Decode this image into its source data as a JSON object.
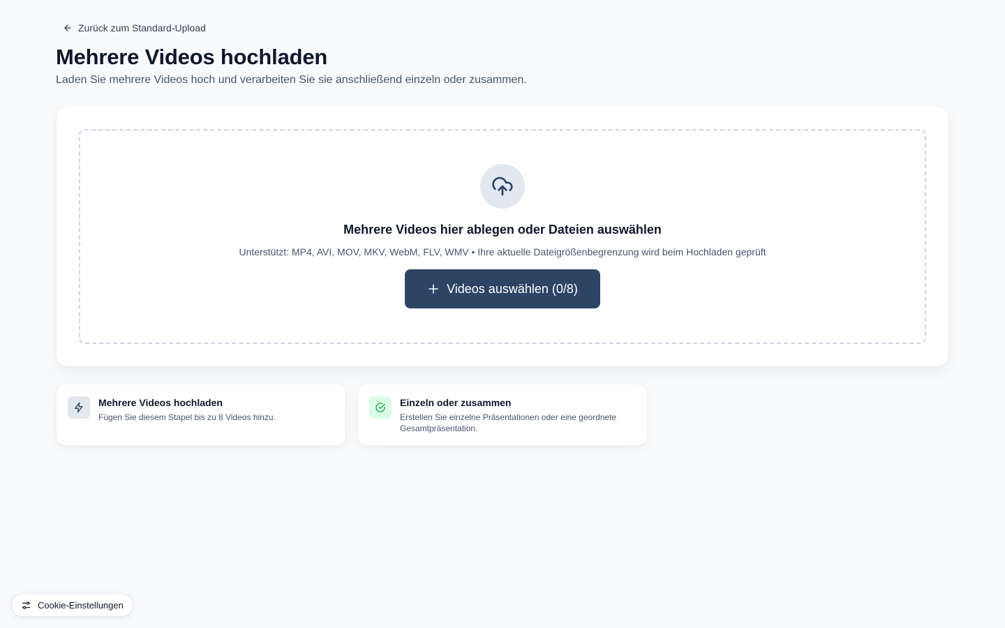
{
  "nav": {
    "back_label": "Zurück zum Standard-Upload"
  },
  "header": {
    "title": "Mehrere Videos hochladen",
    "subtitle": "Laden Sie mehrere Videos hoch und verarbeiten Sie sie anschließend einzeln oder zusammen."
  },
  "dropzone": {
    "title": "Mehrere Videos hier ablegen oder Dateien auswählen",
    "supported": "Unterstützt: MP4, AVI, MOV, MKV, WebM, FLV, WMV • Ihre aktuelle Dateigrößenbegrenzung wird beim Hochladen geprüft",
    "button_label": "Videos auswählen (0/8)"
  },
  "features": [
    {
      "title": "Mehrere Videos hochladen",
      "description": "Fügen Sie diesem Stapel bis zu 8 Videos hinzu.",
      "icon": "lightning-icon"
    },
    {
      "title": "Einzeln oder zusammen",
      "description": "Erstellen Sie einzelne Präsentationen oder eine geordnete Gesamtpräsentation.",
      "icon": "check-circle-icon"
    }
  ],
  "cookie": {
    "label": "Cookie-Einstellungen"
  },
  "colors": {
    "primary_button": "#2d4465",
    "icon_slate": "#2d4465",
    "icon_green": "#16a34a",
    "background": "#f8fafc"
  }
}
